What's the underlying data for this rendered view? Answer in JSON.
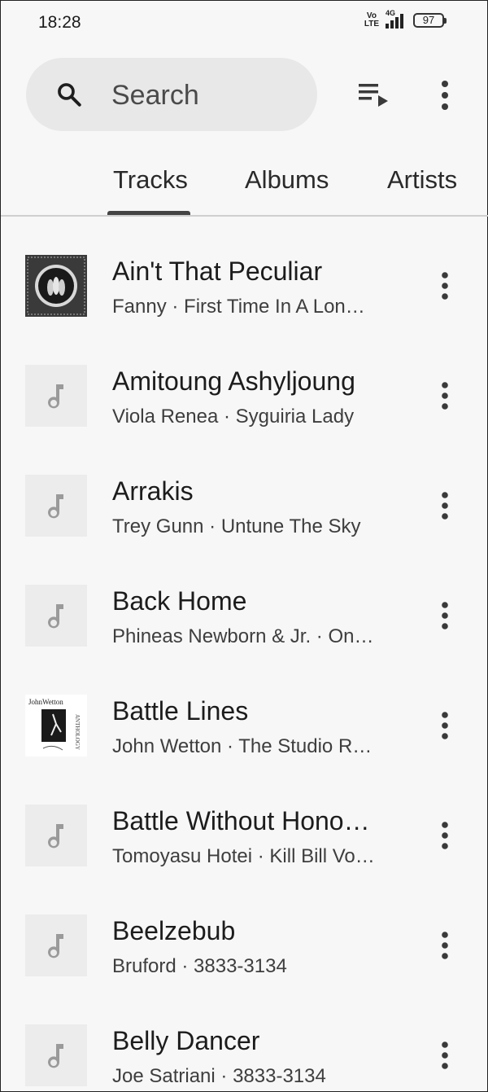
{
  "status_bar": {
    "time": "18:28",
    "volte_top": "Vo",
    "volte_bottom": "LTE",
    "network": "4G",
    "battery": "97"
  },
  "search": {
    "placeholder": "Search"
  },
  "tabs": [
    {
      "label": "Tracks",
      "selected": true
    },
    {
      "label": "Albums",
      "selected": false
    },
    {
      "label": "Artists",
      "selected": false
    }
  ],
  "tracks": [
    {
      "title": "Ain't That Peculiar",
      "subtitle": "Fanny · First Time In A Lon…",
      "art": "album-art"
    },
    {
      "title": "Amitoung Ashyljoung",
      "subtitle": "Viola Renea · Syguiria Lady",
      "art": "music-note-placeholder"
    },
    {
      "title": "Arrakis",
      "subtitle": "Trey Gunn · Untune The Sky",
      "art": "music-note-placeholder"
    },
    {
      "title": "Back Home",
      "subtitle": "Phineas Newborn & Jr. · On…",
      "art": "music-note-placeholder"
    },
    {
      "title": "Battle Lines",
      "subtitle": "John Wetton · The Studio R…",
      "art": "album-art",
      "art_text_top": "JohnWetton",
      "art_text_side": "ANTHOLOGY"
    },
    {
      "title": "Battle Without Hono…",
      "subtitle": "Tomoyasu Hotei · Kill Bill Vo…",
      "art": "music-note-placeholder"
    },
    {
      "title": "Beelzebub",
      "subtitle": "Bruford · 3833-3134",
      "art": "music-note-placeholder"
    },
    {
      "title": "Belly Dancer",
      "subtitle": "Joe Satriani · 3833-3134",
      "art": "music-note-placeholder"
    }
  ],
  "colors": {
    "background": "#f7f7f7",
    "search_fill": "#e8e8e8",
    "tab_indicator": "#444444"
  }
}
